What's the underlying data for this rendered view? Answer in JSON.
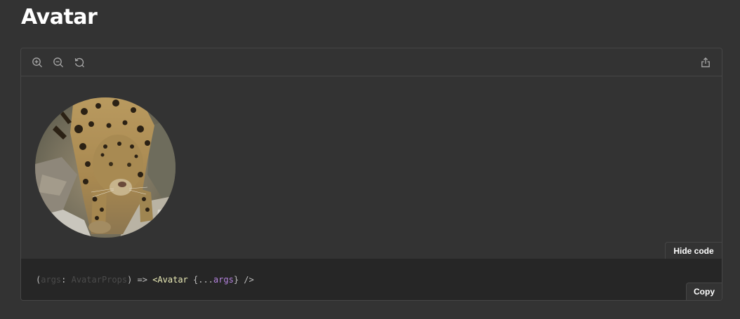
{
  "page": {
    "title": "Avatar"
  },
  "toolbar": {
    "icons": [
      "zoom-in-icon",
      "zoom-out-icon",
      "reset-zoom-icon",
      "share-icon"
    ]
  },
  "preview": {
    "hide_code_label": "Hide code"
  },
  "code": {
    "open_paren": "(",
    "param": "args",
    "colon": ": ",
    "type": "AvatarProps",
    "close_arrow": ") => ",
    "tag_open": "<Avatar",
    "brace_open": " {...",
    "spread": "args",
    "brace_close": "} />",
    "copy_label": "Copy"
  },
  "colors": {
    "background": "#333333",
    "code_background": "#262626",
    "border": "#464646",
    "title_text": "#ffffff",
    "icon": "#a8a8a8",
    "tag_token": "#ecedb8",
    "variable_token": "#b684e0"
  }
}
